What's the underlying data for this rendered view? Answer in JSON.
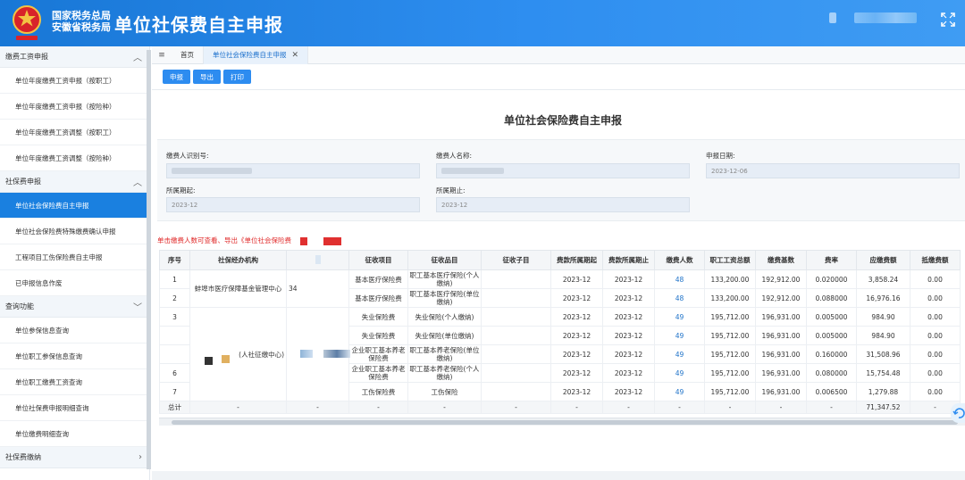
{
  "header": {
    "org_line1": "国家税务总局",
    "org_line2": "安徽省税务局",
    "app_title": "单位社保费自主申报"
  },
  "sidebar": {
    "groups": [
      {
        "label": "缴费工资申报",
        "items": [
          "单位年度缴费工资申报（按职工）",
          "单位年度缴费工资申报（按险种）",
          "单位年度缴费工资调整（按职工）",
          "单位年度缴费工资调整（按险种）"
        ]
      },
      {
        "label": "社保费申报",
        "items": [
          "单位社会保险费自主申报",
          "单位社会保险费特殊缴费确认申报",
          "工程项目工伤保险费自主申报",
          "已申报信息作废"
        ]
      },
      {
        "label": "查询功能",
        "items": [
          "单位参保信息查询",
          "单位职工参保信息查询",
          "单位职工缴费工资查询",
          "单位社保费申报明细查询",
          "单位缴费明细查询"
        ]
      },
      {
        "label": "社保费缴纳",
        "items": []
      }
    ]
  },
  "tabs": [
    {
      "label": "首页"
    },
    {
      "label": "单位社会保险费自主申报"
    }
  ],
  "toolbar": {
    "declare": "申报",
    "export": "导出",
    "print": "打印"
  },
  "page_title": "单位社会保险费自主申报",
  "form": {
    "payer_id_label": "缴费人识别号:",
    "payer_name_label": "缴费人名称:",
    "declare_date_label": "申报日期:",
    "declare_date": "2023-12-06",
    "period_start_label": "所属期起:",
    "period_start": "2023-12",
    "period_end_label": "所属期止:",
    "period_end": "2023-12"
  },
  "hint": "单击缴费人数可查看、导出《单位社会保险费",
  "table": {
    "headers": [
      "序号",
      "社保经办机构",
      "",
      "征收项目",
      "征收品目",
      "征收子目",
      "费款所属期起",
      "费款所属期止",
      "缴费人数",
      "职工工资总额",
      "缴费基数",
      "费率",
      "应缴费额",
      "抵缴费额"
    ],
    "org_a": "蚌埠市医疗保障基金管理中心",
    "org_a_code": "34",
    "org_b": "(人社征缴中心)",
    "rows": [
      {
        "no": "1",
        "item": "基本医疗保险费",
        "sub": "职工基本医疗保险(个人缴纳)",
        "start": "2023-12",
        "end": "2023-12",
        "count": "48",
        "wage": "133,200.00",
        "base": "192,912.00",
        "rate": "0.020000",
        "due": "3,858.24",
        "offset": "0.00"
      },
      {
        "no": "2",
        "item": "基本医疗保险费",
        "sub": "职工基本医疗保险(单位缴纳)",
        "start": "2023-12",
        "end": "2023-12",
        "count": "48",
        "wage": "133,200.00",
        "base": "192,912.00",
        "rate": "0.088000",
        "due": "16,976.16",
        "offset": "0.00"
      },
      {
        "no": "3",
        "item": "失业保险费",
        "sub": "失业保险(个人缴纳)",
        "start": "2023-12",
        "end": "2023-12",
        "count": "49",
        "wage": "195,712.00",
        "base": "196,931.00",
        "rate": "0.005000",
        "due": "984.90",
        "offset": "0.00"
      },
      {
        "no": "",
        "item": "失业保险费",
        "sub": "失业保险(单位缴纳)",
        "start": "2023-12",
        "end": "2023-12",
        "count": "49",
        "wage": "195,712.00",
        "base": "196,931.00",
        "rate": "0.005000",
        "due": "984.90",
        "offset": "0.00"
      },
      {
        "no": "",
        "item": "企业职工基本养老保险费",
        "sub": "职工基本养老保险(单位缴纳)",
        "start": "2023-12",
        "end": "2023-12",
        "count": "49",
        "wage": "195,712.00",
        "base": "196,931.00",
        "rate": "0.160000",
        "due": "31,508.96",
        "offset": "0.00"
      },
      {
        "no": "6",
        "item": "企业职工基本养老保险费",
        "sub": "职工基本养老保险(个人缴纳)",
        "start": "2023-12",
        "end": "2023-12",
        "count": "49",
        "wage": "195,712.00",
        "base": "196,931.00",
        "rate": "0.080000",
        "due": "15,754.48",
        "offset": "0.00"
      },
      {
        "no": "7",
        "item": "工伤保险费",
        "sub": "工伤保险",
        "start": "2023-12",
        "end": "2023-12",
        "count": "49",
        "wage": "195,712.00",
        "base": "196,931.00",
        "rate": "0.006500",
        "due": "1,279.88",
        "offset": "0.00"
      }
    ],
    "total": {
      "label": "总计",
      "dash": "-",
      "due": "71,347.52"
    }
  },
  "colors": {
    "accent": "#2d8cf0",
    "header": "#1877d6",
    "hint": "#e02b2b"
  }
}
